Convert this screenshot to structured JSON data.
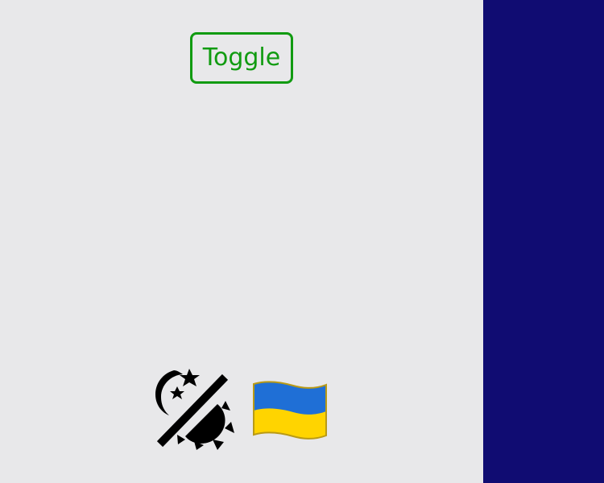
{
  "toggle": {
    "label": "Toggle"
  },
  "icons": {
    "left": "night-day-toggle-icon",
    "right": "ukraine-flag-icon"
  },
  "colors": {
    "main_background": "#e8e8ea",
    "side_panel": "#100c72",
    "toggle_border": "#119b11",
    "toggle_text": "#119b11",
    "flag_blue": "#1f6fd6",
    "flag_yellow": "#ffd400"
  }
}
